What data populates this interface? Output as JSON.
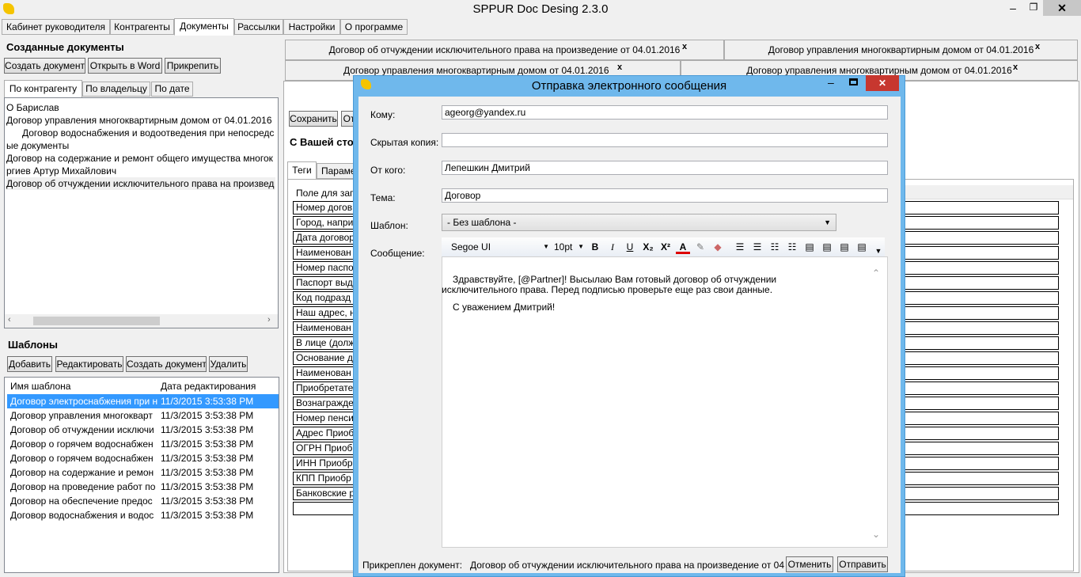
{
  "window": {
    "title": "SPPUR Doc Desing 2.3.0"
  },
  "menu_tabs": [
    {
      "label": "Кабинет руководителя"
    },
    {
      "label": "Контрагенты"
    },
    {
      "label": "Документы"
    },
    {
      "label": "Рассылки"
    },
    {
      "label": "Настройки"
    },
    {
      "label": "О программе"
    }
  ],
  "created_docs": {
    "title": "Созданные документы",
    "buttons": {
      "create": "Создать документ",
      "open_word": "Открыть в Word",
      "attach": "Прикрепить"
    },
    "tabs": [
      "По контрагенту",
      "По владельцу",
      "По дате"
    ],
    "tree": [
      "О Бариcлав",
      "Договор управления многоквартирным домом от 04.01.2016",
      "Договор водоснабжения и водоотведения при непосредс",
      "ые документы",
      "Договор на содержание и ремонт общего имущества многок",
      "ргиев Артур Михайлович",
      "Договор об отчуждении исключительного права на произвед"
    ]
  },
  "templates": {
    "title": "Шаблоны",
    "buttons": {
      "add": "Добавить",
      "edit": "Редактировать",
      "create": "Создать документ",
      "delete": "Удалить"
    },
    "columns": {
      "name": "Имя шаблона",
      "date": "Дата редактирования"
    },
    "rows": [
      {
        "name": "Договор электроснабжения при н",
        "date": "11/3/2015 3:53:38 PM"
      },
      {
        "name": "Договор управления многокварт",
        "date": "11/3/2015 3:53:38 PM"
      },
      {
        "name": "Договор об отчуждении исключи",
        "date": "11/3/2015 3:53:38 PM"
      },
      {
        "name": "Договор о горячем водоснабжен",
        "date": "11/3/2015 3:53:38 PM"
      },
      {
        "name": "Договор о горячем водоснабжен",
        "date": "11/3/2015 3:53:38 PM"
      },
      {
        "name": "Договор на содержание и ремон",
        "date": "11/3/2015 3:53:38 PM"
      },
      {
        "name": "Договор на проведение работ по",
        "date": "11/3/2015 3:53:38 PM"
      },
      {
        "name": "Договор на обеспечение предос",
        "date": "11/3/2015 3:53:38 PM"
      },
      {
        "name": "Договор водоснабжения и водос",
        "date": "11/3/2015 3:53:38 PM"
      }
    ]
  },
  "open_docs": [
    {
      "label": "Договор об отчуждении исключительного права на произведение от 04.01.2016",
      "close": "x"
    },
    {
      "label": "Договор управления многоквартирным домом от 04.01.2016",
      "close": "x"
    },
    {
      "label": "Договор управления многоквартирным домом от 04.01.2016",
      "close": "x"
    },
    {
      "label": "Договор управления многоквартирным домом от 04.01.2016",
      "close": "x"
    }
  ],
  "editor": {
    "save": "Сохранить",
    "other_btn": "От",
    "party_title": "С Вашей сто",
    "tabs": [
      "Теги",
      "Параме"
    ],
    "field_header": "Поле для зап",
    "fields": [
      "Номер догов",
      "Город, напри",
      "Дата договор",
      "Наименован",
      "Номер паспо",
      "Паспорт выд",
      "Код подразд",
      "Наш адрес, н",
      "Наименован",
      "В лице (долж",
      "Основание д",
      "Наименован",
      "Приобретате",
      "Вознагражде",
      "Номер пенси",
      "Адрес Приоб",
      "ОГРН Приоб",
      "ИНН Приобр",
      "КПП Приобр",
      "Банковские р"
    ]
  },
  "dialog": {
    "title": "Отправка электронного сообщения",
    "labels": {
      "to": "Кому:",
      "bcc": "Скрытая копия:",
      "from": "От кого:",
      "subject": "Тема:",
      "template": "Шаблон:",
      "message": "Сообщение:"
    },
    "values": {
      "to": "ageorg@yandex.ru",
      "bcc": "",
      "from": "Лепешкин Дмитрий",
      "subject": "Договор",
      "template": "- Без шаблона -"
    },
    "toolbar": {
      "font": "Segoe UI",
      "size": "10pt",
      "bold": "B",
      "italic": "I",
      "underline": "U"
    },
    "message_lines": [
      "Здравствуйте, [@Partner]! Высылаю Вам готовый договор об отчуждении",
      "исключительного права. Перед подписью проверьте еще раз свои данные.",
      "С уважением Дмитрий!"
    ],
    "attached_label": "Прикреплен документ:",
    "attached_value": "Договор об отчуждении исключительного права на произведение от 04",
    "cancel": "Отменить",
    "send": "Отправить"
  }
}
